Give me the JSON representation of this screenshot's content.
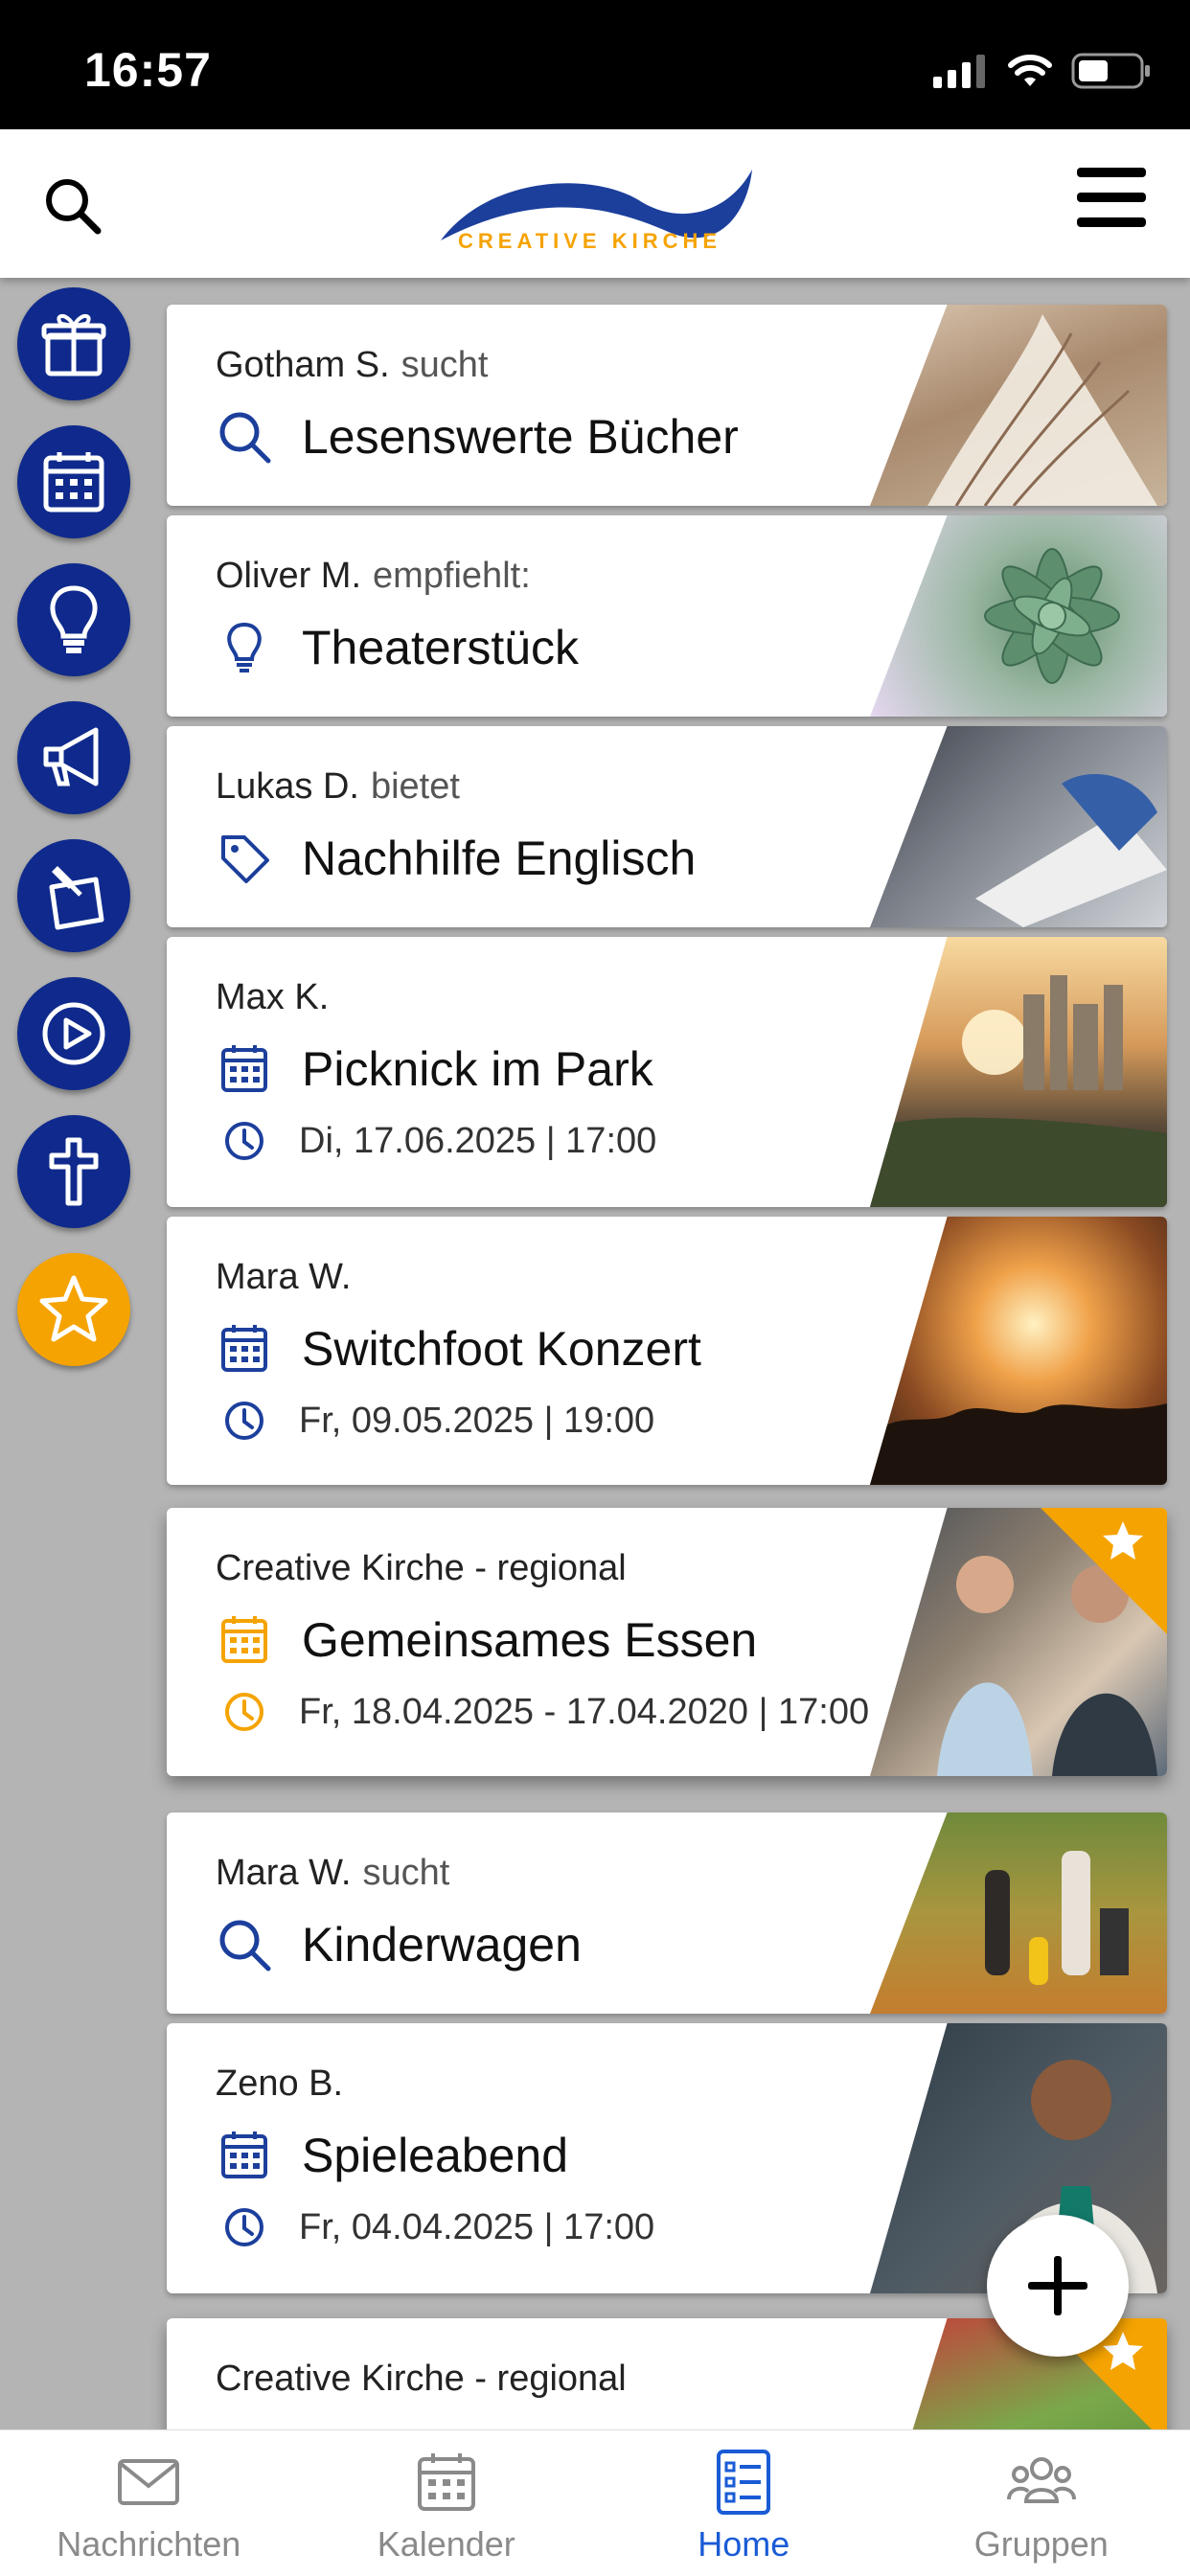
{
  "status_bar": {
    "time": "16:57"
  },
  "header": {
    "logo_text": "CREATIVE KIRCHE",
    "search_icon": "search-icon",
    "menu_icon": "hamburger-menu-icon"
  },
  "side_rail": [
    {
      "name": "gift",
      "icon": "gift-icon"
    },
    {
      "name": "calendar",
      "icon": "calendar-icon"
    },
    {
      "name": "idea",
      "icon": "lightbulb-icon"
    },
    {
      "name": "announce",
      "icon": "megaphone-icon"
    },
    {
      "name": "pin",
      "icon": "pinned-note-icon"
    },
    {
      "name": "video",
      "icon": "play-icon"
    },
    {
      "name": "faith",
      "icon": "cross-icon"
    },
    {
      "name": "favorites",
      "icon": "star-icon"
    }
  ],
  "feed": [
    {
      "author": "Gotham S.",
      "verb": "sucht",
      "icon": "search-icon",
      "title": "Lesenswerte Bücher"
    },
    {
      "author": "Oliver M.",
      "verb": "empfiehlt:",
      "icon": "lightbulb-icon",
      "title": "Theaterstück"
    },
    {
      "author": "Lukas D.",
      "verb": "bietet",
      "icon": "tag-icon",
      "title": "Nachhilfe Englisch"
    },
    {
      "author": "Max K.",
      "verb": "",
      "icon": "calendar-icon",
      "title": "Picknick im Park",
      "date": "Di, 17.06.2025 | 17:00"
    },
    {
      "author": "Mara W.",
      "verb": "",
      "icon": "calendar-icon",
      "title": "Switchfoot Konzert",
      "date": "Fr, 09.05.2025 | 19:00"
    },
    {
      "author": "Creative Kirche - regional",
      "verb": "",
      "icon": "calendar-icon",
      "title": "Gemeinsames Essen",
      "date": "Fr, 18.04.2025 - 17.04.2020 | 17:00",
      "featured": true
    },
    {
      "author": "Mara W.",
      "verb": "sucht",
      "icon": "search-icon",
      "title": "Kinderwagen"
    },
    {
      "author": "Zeno B.",
      "verb": "",
      "icon": "calendar-icon",
      "title": "Spieleabend",
      "date": "Fr, 04.04.2025 | 17:00"
    },
    {
      "author": "Creative Kirche - regional",
      "verb": "",
      "featured": true
    }
  ],
  "fab": {
    "icon": "plus-icon"
  },
  "tab_bar": [
    {
      "label": "Nachrichten",
      "icon": "envelope-icon"
    },
    {
      "label": "Kalender",
      "icon": "calendar-icon"
    },
    {
      "label": "Home",
      "icon": "list-icon",
      "active": true
    },
    {
      "label": "Gruppen",
      "icon": "group-icon"
    }
  ],
  "colors": {
    "brand_blue": "#0f2a8c",
    "accent_orange": "#f5a300",
    "active_tab": "#1a5bd6",
    "background": "#b4b4b4"
  }
}
